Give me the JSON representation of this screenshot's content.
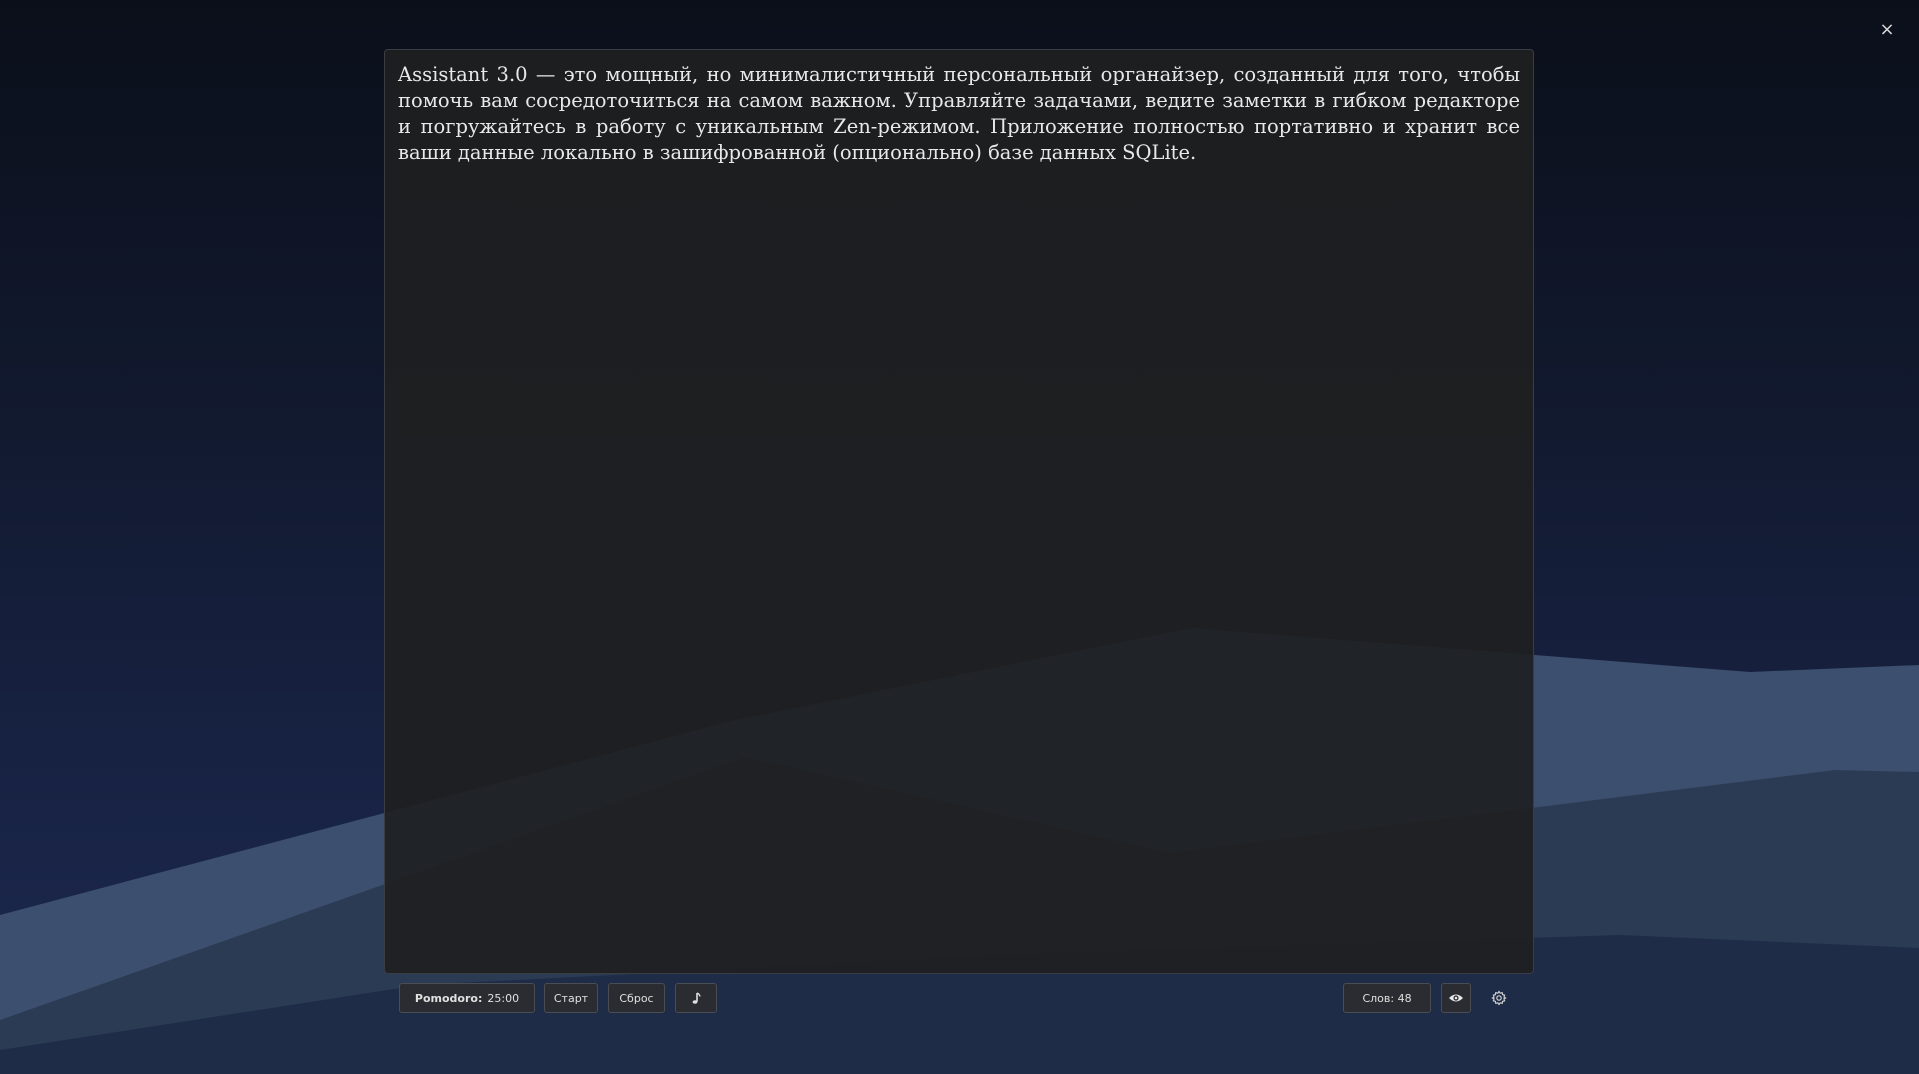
{
  "window": {
    "close_icon": "close-icon",
    "close_glyph": "×"
  },
  "editor": {
    "text": "Assistant 3.0 — это мощный, но минималистичный персональный органайзер, созданный для того, чтобы помочь вам сосредоточиться на самом важном. Управляйте задачами, ведите заметки в гибком редакторе и погружайтесь в работу с уникальным Zen-режимом. Приложение полностью портативно и хранит все ваши данные локально в зашифрованной (опционально) базе данных SQLite."
  },
  "toolbar": {
    "pomodoro_label": "Pomodoro:",
    "pomodoro_time": "25:00",
    "start_label": "Старт",
    "reset_label": "Сброс",
    "music_icon": "music-note-icon",
    "word_count": "Слов: 48",
    "preview_icon": "eye-icon",
    "settings_icon": "gear-icon"
  },
  "colors": {
    "background_top": "#0b0f1a",
    "background_bottom": "#1d2a4f",
    "mountain_light": "#3d5070",
    "mountain_dark": "#2b3a52",
    "editor_bg": "#1e1f21",
    "button_bg": "#2a2c31",
    "button_border": "#4a4d53"
  }
}
